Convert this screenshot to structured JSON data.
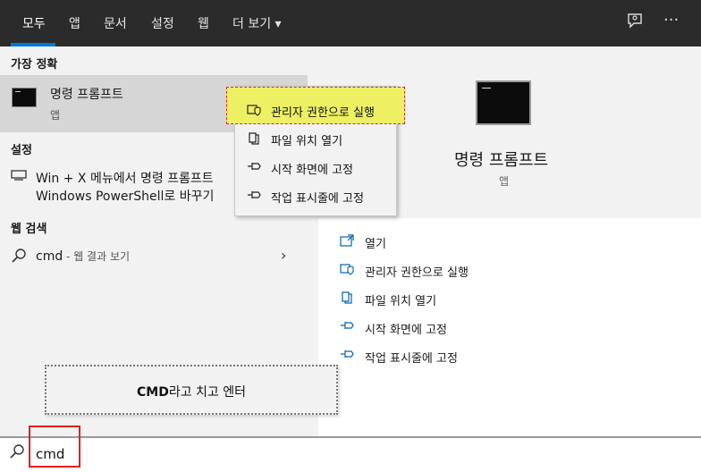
{
  "tabs": [
    "모두",
    "앱",
    "문서",
    "설정",
    "웹",
    "더 보기"
  ],
  "more_caret": "▾",
  "top_icons": {
    "feedback": "feedback-icon",
    "more": "···"
  },
  "best_match": {
    "heading": "가장 정확",
    "name": "명령 프롬프트",
    "type": "앱"
  },
  "settings": {
    "heading": "설정",
    "item_line1": "Win + X 메뉴에서 명령 프롬프트",
    "item_line2": "Windows PowerShell로 바꾸기"
  },
  "web_search": {
    "heading": "웹 검색",
    "query": "cmd",
    "suffix": " - 웹 결과 보기"
  },
  "context_menu": [
    {
      "label": "관리자 권한으로 실행",
      "icon": "shield-icon",
      "highlighted": true
    },
    {
      "label": "파일 위치 열기",
      "icon": "file-icon"
    },
    {
      "label": "시작 화면에 고정",
      "icon": "pin-icon"
    },
    {
      "label": "작업 표시줄에 고정",
      "icon": "pin-icon"
    }
  ],
  "preview": {
    "name": "명령 프롬프트",
    "type": "앱",
    "actions": [
      {
        "label": "열기",
        "icon": "open-icon"
      },
      {
        "label": "관리자 권한으로 실행",
        "icon": "shield-icon"
      },
      {
        "label": "파일 위치 열기",
        "icon": "file-icon"
      },
      {
        "label": "시작 화면에 고정",
        "icon": "pin-icon"
      },
      {
        "label": "작업 표시줄에 고정",
        "icon": "pin-icon"
      }
    ]
  },
  "annotation": {
    "bold": "CMD",
    "rest": "라고 치고 엔터"
  },
  "search": {
    "value": "cmd"
  },
  "colors": {
    "topbar": "#2b2b2b",
    "accent": "#0078d7",
    "highlight": "#eef064",
    "annotation_border": "#e02020"
  }
}
